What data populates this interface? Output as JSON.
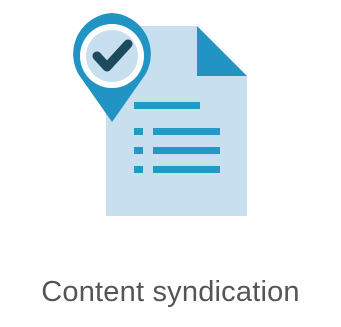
{
  "feature": {
    "title": "Content syndication",
    "icon": "document-with-location-check-icon"
  },
  "colors": {
    "page_light": "#c7dfee",
    "fold": "#2294c3",
    "lines": "#229ac6",
    "pin": "#2294c3",
    "check": "#1d4a5f",
    "text": "#555555"
  }
}
